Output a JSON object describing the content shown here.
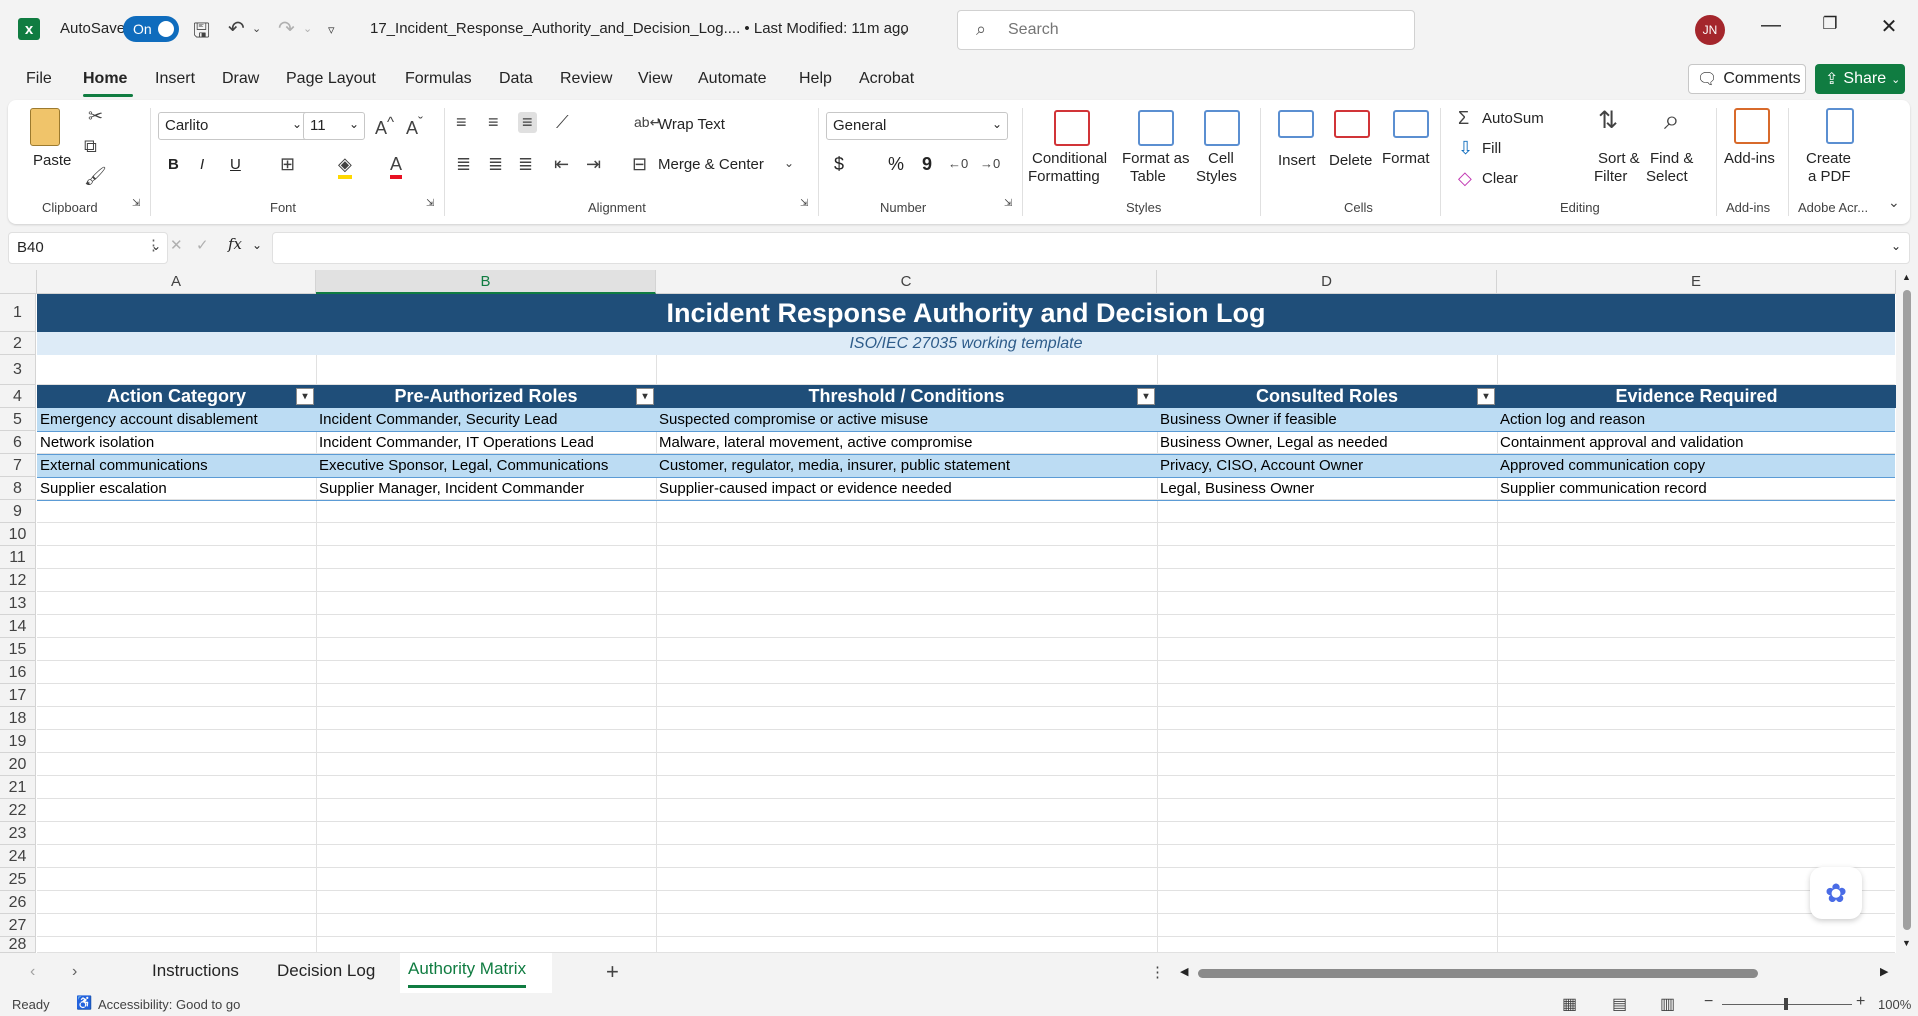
{
  "titlebar": {
    "autosave_label": "AutoSave",
    "autosave_state": "On",
    "document_title": "17_Incident_Response_Authority_and_Decision_Log.... • Last Modified: 11m ago",
    "search_placeholder": "Search",
    "user_initials": "JN"
  },
  "menu": {
    "items": [
      "File",
      "Home",
      "Insert",
      "Draw",
      "Page Layout",
      "Formulas",
      "Data",
      "Review",
      "View",
      "Automate",
      "Help",
      "Acrobat"
    ],
    "active": "Home",
    "comments_label": "Comments",
    "share_label": "Share"
  },
  "ribbon": {
    "clipboard": {
      "paste": "Paste",
      "label": "Clipboard"
    },
    "font": {
      "family": "Carlito",
      "size": "11",
      "bold": "B",
      "italic": "I",
      "underline": "U",
      "label": "Font"
    },
    "alignment": {
      "wrap": "Wrap Text",
      "merge": "Merge & Center",
      "label": "Alignment"
    },
    "number": {
      "format": "General",
      "currency": "$",
      "percent": "%",
      "comma": "9",
      "label": "Number"
    },
    "styles": {
      "conditional_1": "Conditional",
      "conditional_2": "Formatting",
      "format_table_1": "Format as",
      "format_table_2": "Table",
      "cell_styles_1": "Cell",
      "cell_styles_2": "Styles",
      "label": "Styles"
    },
    "cells": {
      "insert": "Insert",
      "delete": "Delete",
      "format": "Format",
      "label": "Cells"
    },
    "editing": {
      "autosum": "AutoSum",
      "fill": "Fill",
      "clear": "Clear",
      "sort_1": "Sort &",
      "sort_2": "Filter",
      "find_1": "Find &",
      "find_2": "Select",
      "label": "Editing"
    },
    "addins": {
      "addins": "Add-ins",
      "label": "Add-ins"
    },
    "adobe": {
      "create_1": "Create",
      "create_2": "a PDF",
      "label": "Adobe Acr..."
    }
  },
  "formula_bar": {
    "name_box": "B40",
    "fx": "fx",
    "content": ""
  },
  "sheet": {
    "columns": [
      "A",
      "B",
      "C",
      "D",
      "E"
    ],
    "selected_column": "B",
    "rows": [
      "1",
      "2",
      "3",
      "4",
      "5",
      "6",
      "7",
      "8",
      "9",
      "10",
      "11",
      "12",
      "13",
      "14",
      "15",
      "16",
      "17",
      "18",
      "19",
      "20",
      "21",
      "22",
      "23",
      "24",
      "25",
      "26",
      "27",
      "28"
    ],
    "title": "Incident Response Authority and Decision Log",
    "subtitle": "ISO/IEC 27035 working template",
    "headers": [
      "Action Category",
      "Pre-Authorized Roles",
      "Threshold / Conditions",
      "Consulted Roles",
      "Evidence Required"
    ],
    "data": [
      [
        "Emergency account disablement",
        "Incident Commander, Security Lead",
        "Suspected compromise or active misuse",
        "Business Owner if feasible",
        "Action log and reason"
      ],
      [
        "Network isolation",
        "Incident Commander, IT Operations Lead",
        "Malware, lateral movement, active compromise",
        "Business Owner, Legal as needed",
        "Containment approval and validation"
      ],
      [
        "External communications",
        "Executive Sponsor, Legal, Communications",
        "Customer, regulator, media, insurer, public statement",
        "Privacy, CISO, Account Owner",
        "Approved communication copy"
      ],
      [
        "Supplier escalation",
        "Supplier Manager, Incident Commander",
        "Supplier-caused impact or evidence needed",
        "Legal, Business Owner",
        "Supplier communication record"
      ]
    ]
  },
  "tabs": {
    "items": [
      "Instructions",
      "Decision Log",
      "Authority Matrix"
    ],
    "active": "Authority Matrix"
  },
  "status": {
    "ready": "Ready",
    "accessibility": "Accessibility: Good to go",
    "zoom": "100%"
  },
  "colors": {
    "excel_green": "#107c41",
    "header_navy": "#1f4e79",
    "band_blue": "#bcdcf3",
    "subtitle_bg": "#ddebf7"
  }
}
